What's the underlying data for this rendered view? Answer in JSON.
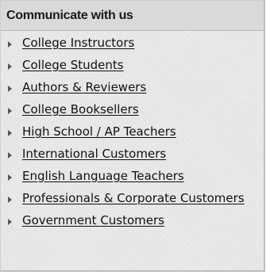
{
  "panel": {
    "title": "Communicate with us",
    "links": [
      "College Instructors",
      "College Students",
      "Authors & Reviewers",
      "College Booksellers",
      "High School / AP Teachers",
      "International Customers",
      "English Language Teachers",
      "Professionals & Corporate Customers",
      "Government Customers"
    ]
  }
}
